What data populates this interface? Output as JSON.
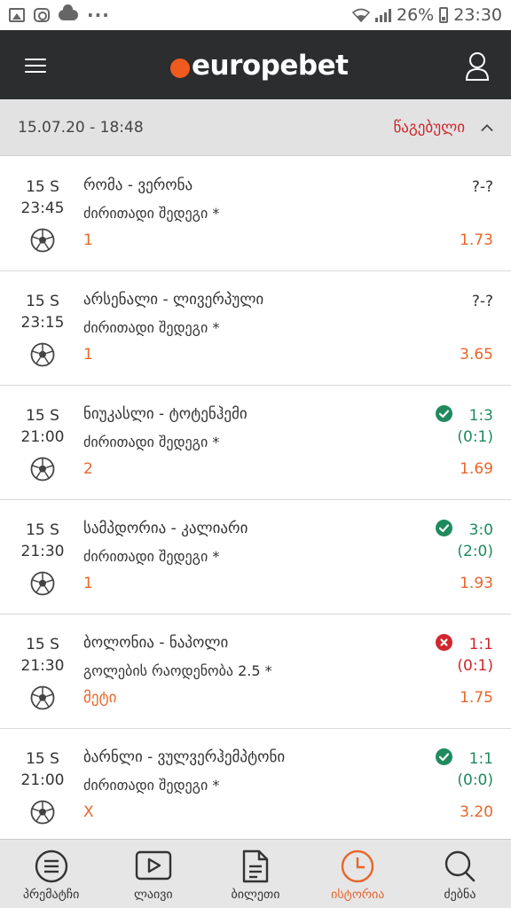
{
  "statusbar": {
    "battery": "26%",
    "time": "23:30"
  },
  "header": {
    "logo_text": "europebet",
    "brand_color": "#ef5a1f"
  },
  "ticket": {
    "datetime": "15.07.20 - 18:48",
    "status": "წაგებული",
    "status_color": "#d0262e"
  },
  "bets": [
    {
      "day": "15 S",
      "time": "23:45",
      "sport_icon": "soccer-ball-icon",
      "match": "რომა - ვერონა",
      "market": "ძირითადი შედეგი *",
      "selection": "1",
      "score": "?-?",
      "score_ht": "",
      "result": "pending",
      "odds": "1.73"
    },
    {
      "day": "15 S",
      "time": "23:15",
      "sport_icon": "soccer-ball-icon",
      "match": "არსენალი - ლივერპული",
      "market": "ძირითადი შედეგი *",
      "selection": "1",
      "score": "?-?",
      "score_ht": "",
      "result": "pending",
      "odds": "3.65"
    },
    {
      "day": "15 S",
      "time": "21:00",
      "sport_icon": "soccer-ball-icon",
      "match": "ნიუკასლი - ტოტენჰემი",
      "market": "ძირითადი შედეგი *",
      "selection": "2",
      "score": "1:3",
      "score_ht": "(0:1)",
      "result": "win",
      "odds": "1.69"
    },
    {
      "day": "15 S",
      "time": "21:30",
      "sport_icon": "soccer-ball-icon",
      "match": "სამპდორია - კალიარი",
      "market": "ძირითადი შედეგი *",
      "selection": "1",
      "score": "3:0",
      "score_ht": "(2:0)",
      "result": "win",
      "odds": "1.93"
    },
    {
      "day": "15 S",
      "time": "21:30",
      "sport_icon": "soccer-ball-icon",
      "match": "ბოლონია - ნაპოლი",
      "market": "გოლების რაოდენობა 2.5 *",
      "selection": "მეტი",
      "score": "1:1",
      "score_ht": "(0:1)",
      "result": "lose",
      "odds": "1.75"
    },
    {
      "day": "15 S",
      "time": "21:00",
      "sport_icon": "soccer-ball-icon",
      "match": "ბარნლი - ვულვერჰემპტონი",
      "market": "ძირითადი შედეგი *",
      "selection": "X",
      "score": "1:1",
      "score_ht": "(0:0)",
      "result": "win",
      "odds": "3.20"
    }
  ],
  "nav": {
    "prematch": "პრემატჩი",
    "live": "ლაივი",
    "tickets": "ბილეთი",
    "history": "ისტორია",
    "search": "ძებნა",
    "active_color": "#e8652a"
  }
}
